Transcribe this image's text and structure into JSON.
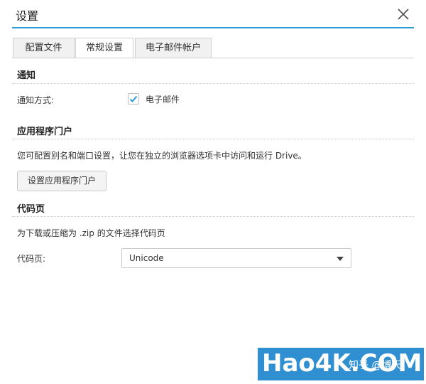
{
  "dialog": {
    "title": "设置"
  },
  "tabs": [
    {
      "label": "配置文件"
    },
    {
      "label": "常规设置",
      "active": true
    },
    {
      "label": "电子邮件帐户"
    }
  ],
  "notification": {
    "heading": "通知",
    "method_label": "通知方式:",
    "email_checkbox": {
      "label": "电子邮件",
      "checked": true
    }
  },
  "portal": {
    "heading": "应用程序门户",
    "description": "您可配置别名和端口设置，让您在独立的浏览器选项卡中访问和运行 Drive。",
    "button_label": "设置应用程序门户"
  },
  "codepage": {
    "heading": "代码页",
    "description": "为下载或压缩为 .zip 的文件选择代码页",
    "field_label": "代码页:",
    "selected": "Unicode"
  },
  "watermark": {
    "text": "Hao4K.COM",
    "zh": "知乎 @博天"
  },
  "colors": {
    "accent": "#2a9bd6",
    "check": "#2a9bd6",
    "watermark_bg": "#2f8fd0"
  },
  "icons": {
    "close": "close-icon",
    "check": "check-icon",
    "dropdown": "chevron-down-icon"
  }
}
